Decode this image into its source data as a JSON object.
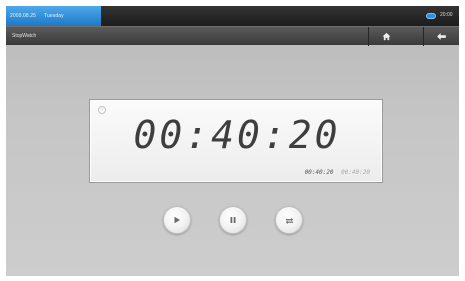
{
  "status_bar": {
    "date": "2009.08.25",
    "weekday": "Tuesday",
    "time": "20:00"
  },
  "title_bar": {
    "title": "StopWatch"
  },
  "stopwatch": {
    "main_time": "00:40:20",
    "lap_current": "00:40:20",
    "lap_previous": "00:40:20"
  },
  "icons": {
    "home": "home-icon",
    "back": "back-arrow-icon",
    "play": "play-icon",
    "pause": "pause-icon",
    "reset": "reset-icon",
    "battery": "battery-icon",
    "info": "info-icon"
  },
  "colors": {
    "accent": "#2f8fe0",
    "status_bar": "#1c1c1c",
    "title_bar": "#3a3a3a",
    "background": "#c6c6c6"
  }
}
